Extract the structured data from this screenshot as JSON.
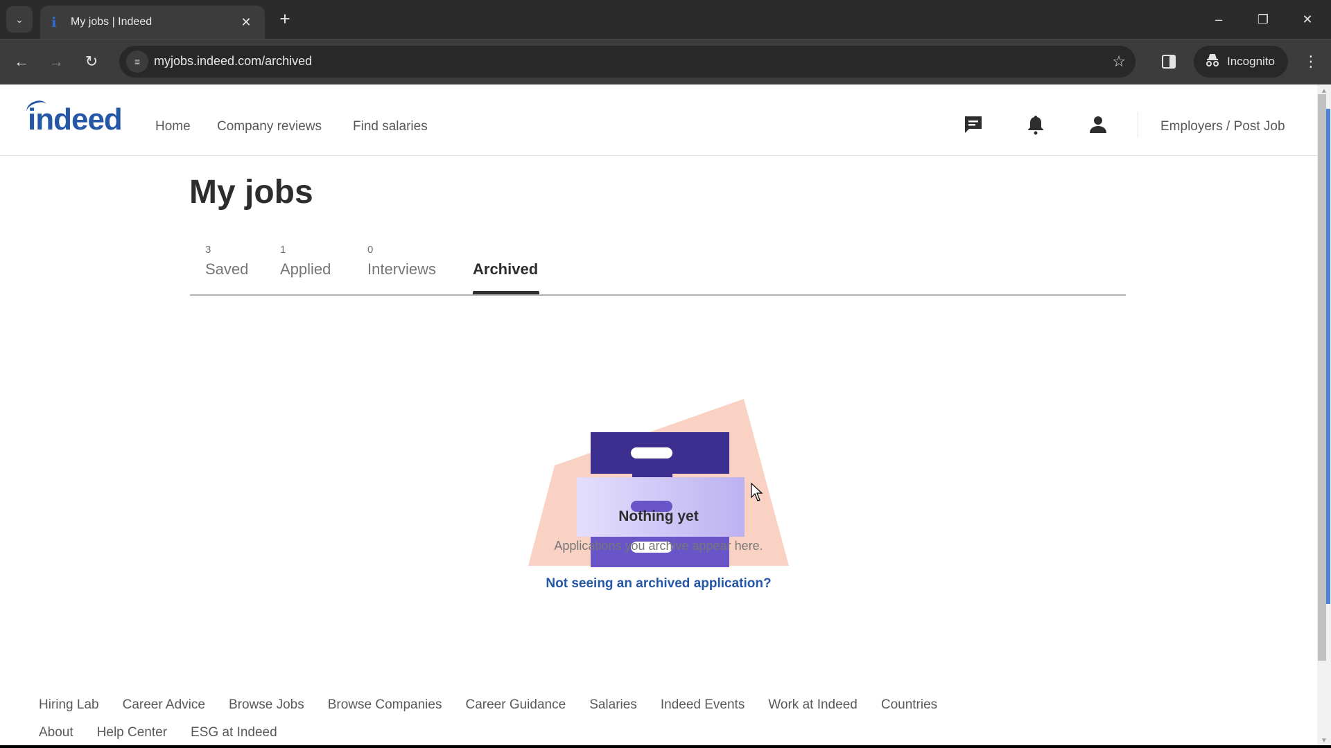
{
  "browser": {
    "tab_title": "My jobs | Indeed",
    "url": "myjobs.indeed.com/archived",
    "incognito_label": "Incognito",
    "icons": {
      "tab_search": "chevron-down-icon",
      "favicon": "indeed-favicon",
      "close": "close-icon",
      "new_tab": "plus-icon",
      "back": "arrow-left-icon",
      "forward": "arrow-right-icon",
      "reload": "reload-icon",
      "site_info": "tune-icon",
      "bookmark": "star-icon",
      "side_panel": "side-panel-icon",
      "incognito": "incognito-icon",
      "menu": "kebab-menu-icon",
      "minimize": "minimize-icon",
      "restore": "restore-icon",
      "window_close": "close-icon"
    }
  },
  "header": {
    "logo": "indeed",
    "nav": [
      {
        "label": "Home"
      },
      {
        "label": "Company reviews"
      },
      {
        "label": "Find salaries"
      }
    ],
    "icons": [
      "messages-icon",
      "notifications-bell-icon",
      "account-icon"
    ],
    "employers_link": "Employers / Post Job"
  },
  "main": {
    "title": "My jobs",
    "tabs": [
      {
        "count": "3",
        "label": "Saved",
        "active": false
      },
      {
        "count": "1",
        "label": "Applied",
        "active": false
      },
      {
        "count": "0",
        "label": "Interviews",
        "active": false
      },
      {
        "count": "",
        "label": "Archived",
        "active": true
      }
    ],
    "empty_state": {
      "illustration": "file-drawer-illustration",
      "title": "Nothing yet",
      "description": "Applications you archive appear here.",
      "link": "Not seeing an archived application?"
    }
  },
  "footer": {
    "row1": [
      "Hiring Lab",
      "Career Advice",
      "Browse Jobs",
      "Browse Companies",
      "Career Guidance",
      "Salaries",
      "Indeed Events",
      "Work at Indeed",
      "Countries"
    ],
    "row2": [
      "About",
      "Help Center",
      "ESG at Indeed"
    ]
  },
  "colors": {
    "brand_blue": "#2557a7",
    "text_dark": "#2d2d2d",
    "text_muted": "#767676",
    "illustration_peach": "#f9d2c4",
    "illustration_dark_purple": "#3d2f8f",
    "illustration_light_purple": "#cfc8f6",
    "illustration_mid_purple": "#6a55c8"
  }
}
